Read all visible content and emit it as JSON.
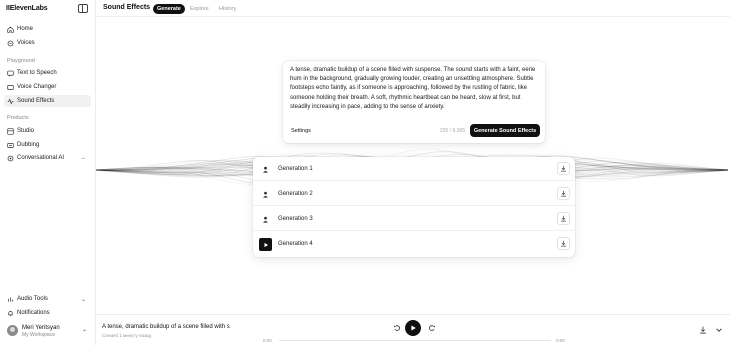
{
  "sidebar": {
    "logo": "IIElevenLabs",
    "top_items": [
      {
        "label": "Home",
        "icon": "home-icon"
      },
      {
        "label": "Voices",
        "icon": "voices-icon"
      }
    ],
    "playground_label": "Playground",
    "playground_items": [
      {
        "label": "Text to Speech",
        "icon": "text-to-speech-icon"
      },
      {
        "label": "Voice Changer",
        "icon": "voice-changer-icon"
      },
      {
        "label": "Sound Effects",
        "icon": "sound-effects-icon",
        "active": true
      }
    ],
    "products_label": "Products",
    "product_items": [
      {
        "label": "Studio",
        "icon": "studio-icon"
      },
      {
        "label": "Dubbing",
        "icon": "dubbing-icon"
      },
      {
        "label": "Conversational AI",
        "icon": "conversational-ai-icon"
      }
    ],
    "bottom_items": [
      {
        "label": "Audio Tools",
        "icon": "audio-tools-icon"
      },
      {
        "label": "Notifications",
        "icon": "bell-icon"
      }
    ],
    "user": {
      "name": "Meri Yeritsyan",
      "workspace": "My Workspace"
    }
  },
  "header": {
    "title": "Sound Effects",
    "tabs": [
      {
        "label": "Generate",
        "active": true
      },
      {
        "label": "Explore"
      },
      {
        "label": "History"
      }
    ]
  },
  "prompt": {
    "text": "A tense, dramatic buildup of a scene filled with suspense. The sound starts with a faint, eerie hum in the background, gradually growing louder, creating an unsettling atmosphere. Subtle footsteps echo faintly, as if someone is approaching, followed by the rustling of fabric, like someone holding their breath. A soft, rhythmic heartbeat can be heard, slow at first, but steadily increasing in pace, adding to the sense of anxiety.",
    "settings_label": "Settings",
    "char_count": "225 / 9,365",
    "generate_label": "Generate Sound Effects"
  },
  "generations": [
    {
      "label": "Generation 1",
      "state": "loading"
    },
    {
      "label": "Generation 2",
      "state": "loading"
    },
    {
      "label": "Generation 3",
      "state": "loading"
    },
    {
      "label": "Generation 4",
      "state": "ready"
    }
  ],
  "player": {
    "title": "A tense, dramatic buildup of a scene filled with s",
    "subtitle": "Created 1 минуту назад",
    "time_start": "0:00",
    "time_end": "0:00",
    "progress": 0
  },
  "colors": {
    "accent": "#111111",
    "muted": "#999999"
  }
}
